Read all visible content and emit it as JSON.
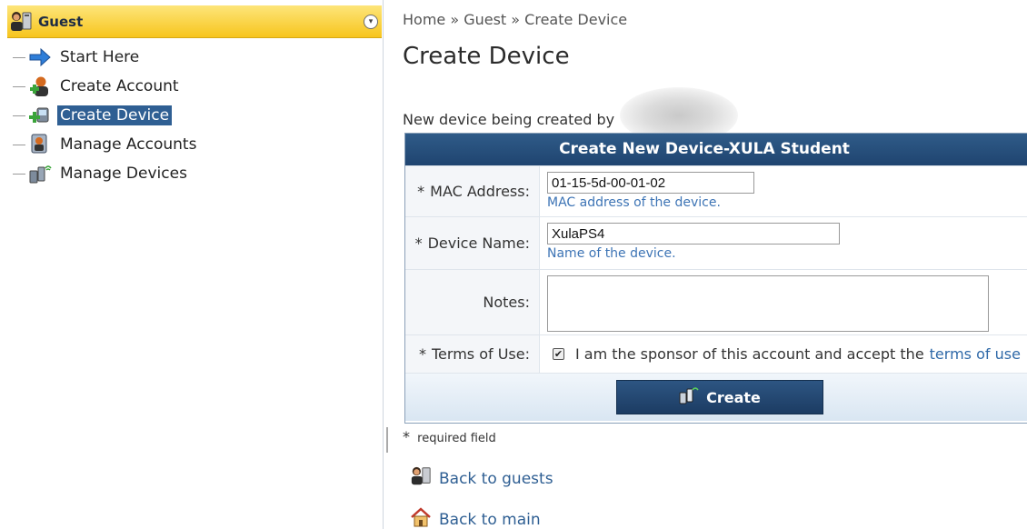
{
  "sidebar": {
    "header_title": "Guest",
    "collapse_glyph": "⊙",
    "items": [
      {
        "label": "Start Here",
        "icon": "arrow-right-icon"
      },
      {
        "label": "Create Account",
        "icon": "add-user-icon"
      },
      {
        "label": "Create Device",
        "icon": "add-device-icon",
        "selected": true
      },
      {
        "label": "Manage Accounts",
        "icon": "manage-accounts-icon"
      },
      {
        "label": "Manage Devices",
        "icon": "devices-icon"
      }
    ]
  },
  "breadcrumb": "Home » Guest » Create Device",
  "page_title": "Create Device",
  "created_by_text": "New device being created by",
  "form": {
    "title": "Create New Device-XULA Student",
    "required_star": "*",
    "mac_label": "MAC Address:",
    "mac_value": "01-15-5d-00-01-02",
    "mac_hint": "MAC address of the device.",
    "name_label": "Device Name:",
    "name_value": "XulaPS4",
    "name_hint": "Name of the device.",
    "notes_label": "Notes:",
    "notes_value": "",
    "terms_label": "Terms of Use:",
    "terms_checked": true,
    "terms_text": "I am the sponsor of this account and accept the",
    "terms_link": "terms of use",
    "create_button": "Create"
  },
  "required_field_note": "required field",
  "back_to_guests": "Back to guests",
  "back_to_main": "Back to main",
  "colors": {
    "header_gold": "#f7c51d",
    "form_header_blue": "#1f4470",
    "selected_blue": "#2f5f93",
    "link_blue": "#2f69a8"
  }
}
